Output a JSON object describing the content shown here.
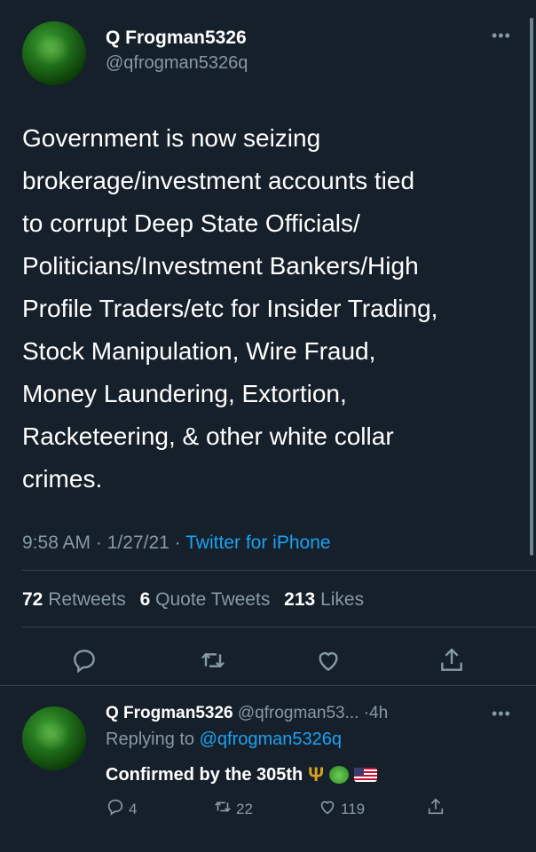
{
  "tweet": {
    "display_name": "Q Frogman5326",
    "handle": "@qfrogman5326q",
    "more_icon": "ellipsis-icon",
    "text": "Government is now seizing\nbrokerage/investment accounts tied\nto corrupt Deep State Officials/\nPoliticians/Investment Bankers/High\nProfile Traders/etc for Insider Trading,\nStock Manipulation, Wire Fraud,\nMoney Laundering, Extortion,\nRacketeering, & other white collar\ncrimes.",
    "time": "9:58 AM",
    "date": "1/27/21",
    "separator": "·",
    "source": "Twitter for iPhone",
    "stats": {
      "retweets_count": "72",
      "retweets_label": "Retweets",
      "quotes_count": "6",
      "quotes_label": "Quote Tweets",
      "likes_count": "213",
      "likes_label": "Likes"
    }
  },
  "reply": {
    "display_name": "Q Frogman5326",
    "handle": "@qfrogman53...",
    "time": "4h",
    "separator": "·",
    "replying_prefix": "Replying to",
    "replying_handle": "@qfrogman5326q",
    "text": "Confirmed by the 305th",
    "emojis": [
      "trident-emoji",
      "frog-emoji",
      "us-flag-emoji"
    ],
    "trident_glyph": "Ψ",
    "replies_count": "4",
    "retweets_count": "22",
    "likes_count": "119"
  },
  "colors": {
    "background": "#15202b",
    "muted": "#8899a6",
    "link": "#1da1f2",
    "divider": "#38444d"
  }
}
